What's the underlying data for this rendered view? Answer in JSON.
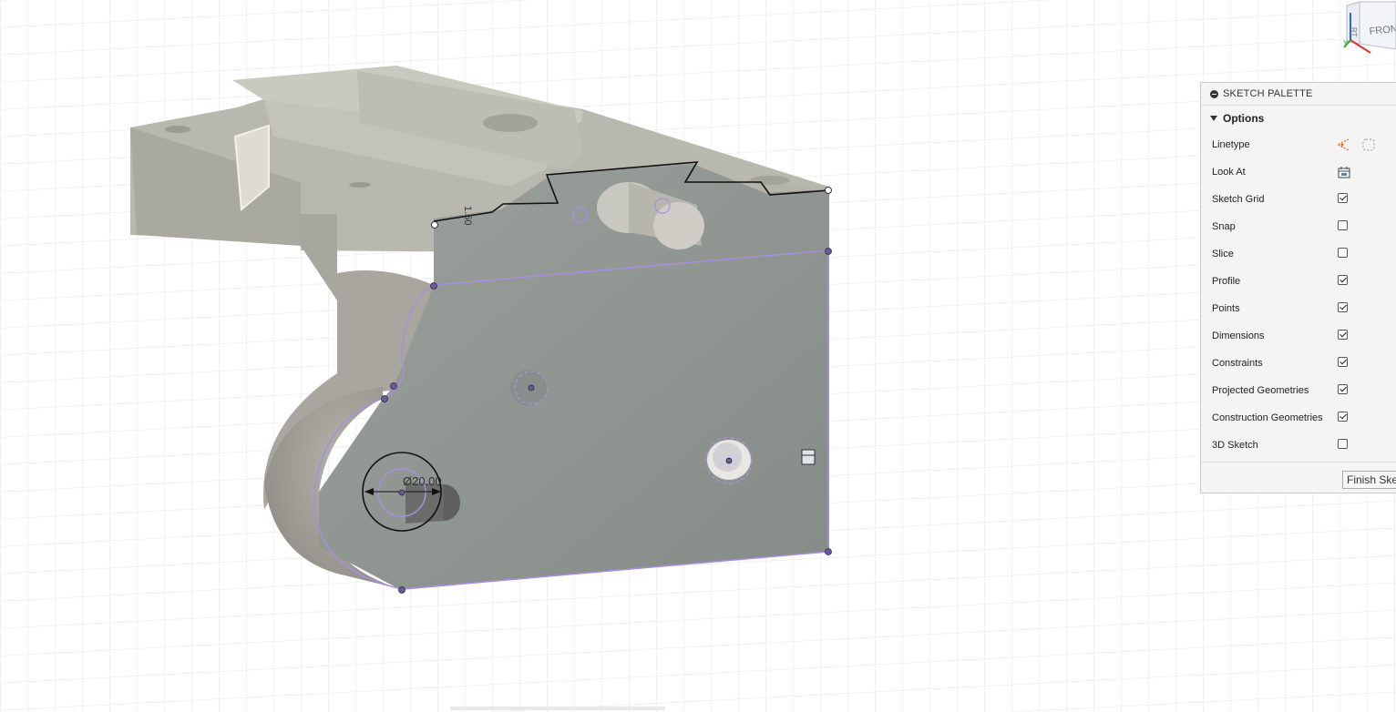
{
  "palette": {
    "title": "SKETCH PALETTE",
    "section": "Options",
    "rows": [
      {
        "label": "Linetype",
        "control": "linetype"
      },
      {
        "label": "Look At",
        "control": "lookat"
      },
      {
        "label": "Sketch Grid",
        "control": "checkbox",
        "checked": true
      },
      {
        "label": "Snap",
        "control": "checkbox",
        "checked": false
      },
      {
        "label": "Slice",
        "control": "checkbox",
        "checked": false
      },
      {
        "label": "Profile",
        "control": "checkbox",
        "checked": true
      },
      {
        "label": "Points",
        "control": "checkbox",
        "checked": true
      },
      {
        "label": "Dimensions",
        "control": "checkbox",
        "checked": true
      },
      {
        "label": "Constraints",
        "control": "checkbox",
        "checked": true
      },
      {
        "label": "Projected Geometries",
        "control": "checkbox",
        "checked": true
      },
      {
        "label": "Construction Geometries",
        "control": "checkbox",
        "checked": true
      },
      {
        "label": "3D Sketch",
        "control": "checkbox",
        "checked": false
      }
    ],
    "finish_label": "Finish Sketch"
  },
  "viewcube": {
    "face_front": "FRONT",
    "face_side": "RIGHT",
    "axis_y": "Y"
  },
  "dimensions": {
    "diameter": "Ø20.00",
    "small": "1.50"
  },
  "colors": {
    "sketch": "#a98ee0",
    "body": "#8e948f",
    "accent": "#e06a1b"
  }
}
